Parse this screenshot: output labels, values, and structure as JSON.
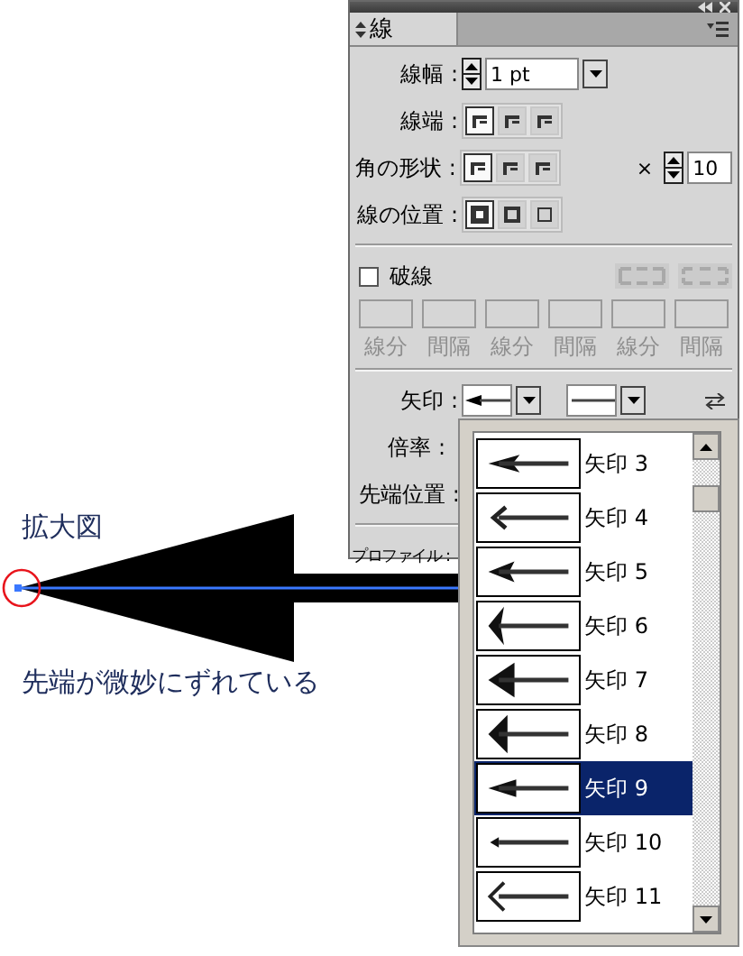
{
  "illustration": {
    "caption": "拡大図",
    "note": "先端が微妙にずれている"
  },
  "panel": {
    "tab": {
      "label": "線",
      "selected": true
    },
    "weight": {
      "label": "線幅 :",
      "value": "1 pt"
    },
    "cap": {
      "label": "線端 :",
      "options": [
        {
          "selected": true
        },
        {
          "selected": false
        },
        {
          "selected": false
        }
      ]
    },
    "corner": {
      "label": "角の形状 :",
      "options": [
        {
          "selected": true
        },
        {
          "selected": false
        },
        {
          "selected": false
        }
      ],
      "limit_sign": "×",
      "limit": "10"
    },
    "align": {
      "label": "線の位置 :",
      "options": [
        {
          "selected": true
        },
        {
          "selected": false
        },
        {
          "selected": false
        }
      ]
    },
    "dashed": {
      "label": "破線",
      "checked": false
    },
    "dash_fields": [
      {
        "label": "線分",
        "disabled": true
      },
      {
        "label": "間隔",
        "disabled": true
      },
      {
        "label": "線分",
        "disabled": true
      },
      {
        "label": "間隔",
        "disabled": true
      },
      {
        "label": "線分",
        "disabled": true
      },
      {
        "label": "間隔",
        "disabled": true
      }
    ],
    "arrowheads": {
      "label": "矢印 :"
    },
    "scale": {
      "label": "倍率 :"
    },
    "tip": {
      "label": "先端位置 :"
    },
    "profile": {
      "label": "プロファイル :"
    }
  },
  "arrow_list": {
    "items": [
      {
        "label": "矢印 3",
        "selected": false
      },
      {
        "label": "矢印 4",
        "selected": false
      },
      {
        "label": "矢印 5",
        "selected": false
      },
      {
        "label": "矢印 6",
        "selected": false
      },
      {
        "label": "矢印 7",
        "selected": false
      },
      {
        "label": "矢印 8",
        "selected": false
      },
      {
        "label": "矢印 9",
        "selected": true
      },
      {
        "label": "矢印 10",
        "selected": false
      },
      {
        "label": "矢印 11",
        "selected": false
      }
    ]
  }
}
